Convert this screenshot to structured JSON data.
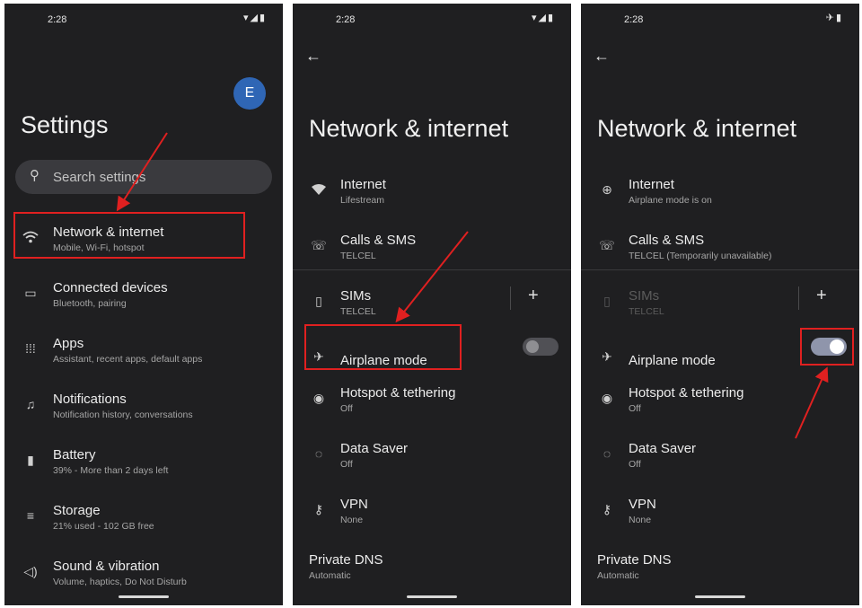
{
  "status": {
    "time": "2:28"
  },
  "panel1": {
    "avatar_letter": "E",
    "title": "Settings",
    "search_placeholder": "Search settings",
    "items": [
      {
        "icon": "wifi-icon",
        "label": "Network & internet",
        "sub": "Mobile, Wi-Fi, hotspot"
      },
      {
        "icon": "devices-icon",
        "label": "Connected devices",
        "sub": "Bluetooth, pairing"
      },
      {
        "icon": "apps-grid-icon",
        "label": "Apps",
        "sub": "Assistant, recent apps, default apps"
      },
      {
        "icon": "bell-icon",
        "label": "Notifications",
        "sub": "Notification history, conversations"
      },
      {
        "icon": "battery-icon",
        "label": "Battery",
        "sub": "39% - More than 2 days left"
      },
      {
        "icon": "storage-icon",
        "label": "Storage",
        "sub": "21% used - 102 GB free"
      },
      {
        "icon": "speaker-icon",
        "label": "Sound & vibration",
        "sub": "Volume, haptics, Do Not Disturb"
      }
    ]
  },
  "panel2": {
    "title": "Network & internet",
    "items": [
      {
        "icon": "wifi-icon",
        "label": "Internet",
        "sub": "Lifestream"
      },
      {
        "icon": "calls-sms-icon",
        "label": "Calls & SMS",
        "sub": "TELCEL"
      },
      {
        "icon": "sim-icon",
        "label": "SIMs",
        "sub": "TELCEL"
      },
      {
        "icon": "airplane-icon",
        "label": "Airplane mode",
        "sub": ""
      },
      {
        "icon": "hotspot-icon",
        "label": "Hotspot & tethering",
        "sub": "Off"
      },
      {
        "icon": "data-saver-icon",
        "label": "Data Saver",
        "sub": "Off"
      },
      {
        "icon": "vpn-key-icon",
        "label": "VPN",
        "sub": "None"
      },
      {
        "icon": "",
        "label": "Private DNS",
        "sub": "Automatic"
      }
    ],
    "airplane_mode_on": false
  },
  "panel3": {
    "title": "Network & internet",
    "items": [
      {
        "icon": "globe-off-icon",
        "label": "Internet",
        "sub": "Airplane mode is on"
      },
      {
        "icon": "calls-sms-icon",
        "label": "Calls & SMS",
        "sub": "TELCEL (Temporarily unavailable)"
      },
      {
        "icon": "sim-icon",
        "label": "SIMs",
        "sub": "TELCEL"
      },
      {
        "icon": "airplane-icon",
        "label": "Airplane mode",
        "sub": ""
      },
      {
        "icon": "hotspot-icon",
        "label": "Hotspot & tethering",
        "sub": "Off"
      },
      {
        "icon": "data-saver-icon",
        "label": "Data Saver",
        "sub": "Off"
      },
      {
        "icon": "vpn-key-icon",
        "label": "VPN",
        "sub": "None"
      },
      {
        "icon": "",
        "label": "Private DNS",
        "sub": "Automatic"
      }
    ],
    "airplane_mode_on": true
  },
  "colors": {
    "background": "#1f1f21",
    "highlight": "#e02020",
    "avatar": "#2f66b5"
  }
}
